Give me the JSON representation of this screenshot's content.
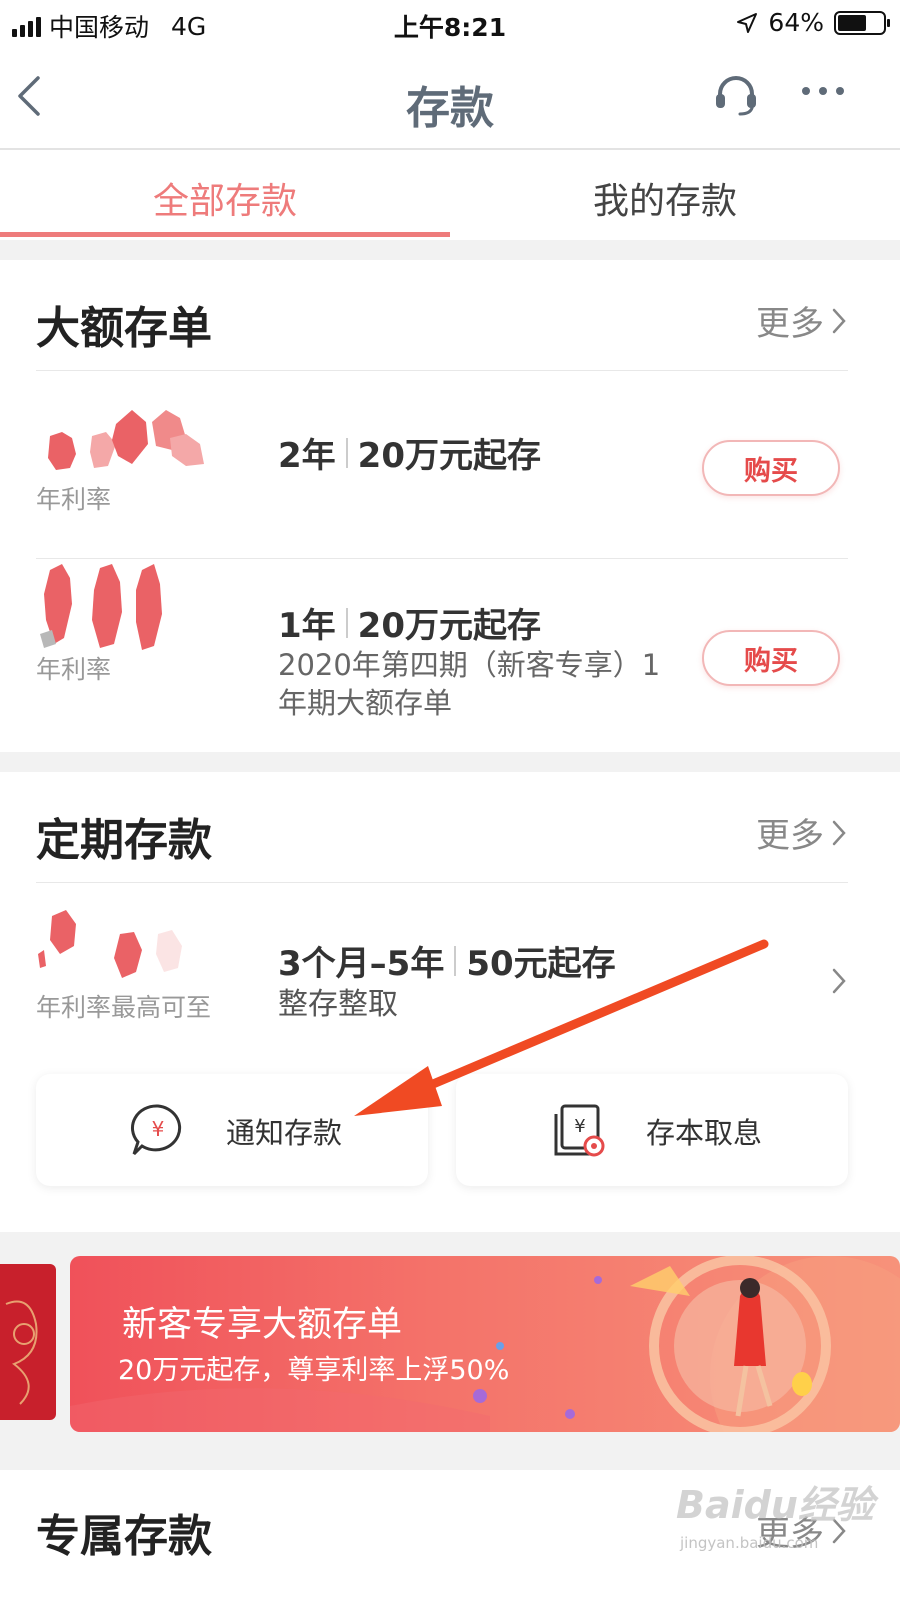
{
  "status_bar": {
    "carrier": "中国移动",
    "network": "4G",
    "time": "上午8:21",
    "battery": "64%",
    "battery_level": 0.64
  },
  "nav": {
    "title": "存款"
  },
  "tabs": [
    {
      "label": "全部存款",
      "active": true
    },
    {
      "label": "我的存款",
      "active": false
    }
  ],
  "large_cd": {
    "title": "大额存单",
    "more": "更多",
    "products": [
      {
        "rate_label": "年利率",
        "term": "2年",
        "min": "20万元起存",
        "desc": "",
        "button": "购买"
      },
      {
        "rate_label": "年利率",
        "term": "1年",
        "min": "20万元起存",
        "desc": "2020年第四期（新客专享）1年期大额存单",
        "button": "购买"
      }
    ]
  },
  "fixed": {
    "title": "定期存款",
    "more": "更多",
    "product": {
      "rate_label": "年利率最高可至",
      "term": "3个月–5年",
      "min": "50元起存",
      "desc": "整存整取"
    }
  },
  "quick": [
    {
      "label": "通知存款",
      "icon": "yuan-chat-icon"
    },
    {
      "label": "存本取息",
      "icon": "yuan-docs-icon"
    }
  ],
  "banner": {
    "title": "新客专享大额存单",
    "subtitle": "20万元起存，尊享利率上浮50%"
  },
  "exclusive": {
    "title": "专属存款",
    "more": "更多"
  },
  "watermark": {
    "text": "Baidu经验",
    "url": "jingyan.baidu.com"
  },
  "colors": {
    "accent": "#ee7b7b",
    "buy": "#e54b4b",
    "arrow": "#f04a23"
  }
}
